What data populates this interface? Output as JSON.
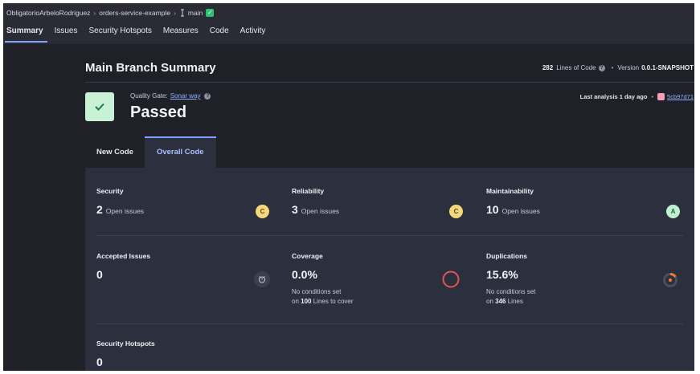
{
  "breadcrumb": {
    "organization": "ObligatorioArbeloRodriguez",
    "project": "orders-service-example",
    "separator": "›",
    "branch": "main"
  },
  "nav": {
    "tabs": [
      "Summary",
      "Issues",
      "Security Hotspots",
      "Measures",
      "Code",
      "Activity"
    ],
    "active": "Summary"
  },
  "summary": {
    "title": "Main Branch Summary",
    "lines_of_code_value": "282",
    "lines_of_code_label": "Lines of Code",
    "version_label": "Version",
    "version_value": "0.0.1-SNAPSHOT"
  },
  "quality_gate": {
    "label": "Quality Gate:",
    "link": "Sonar way",
    "status": "Passed",
    "last_analysis": "Last analysis 1 day ago",
    "commit": "5cb97d71"
  },
  "code_tabs": {
    "new_code": "New Code",
    "overall_code": "Overall Code",
    "active": "Overall Code"
  },
  "measures": {
    "security": {
      "title": "Security",
      "value": "2",
      "unit": "Open issues",
      "rating": "C"
    },
    "reliability": {
      "title": "Reliability",
      "value": "3",
      "unit": "Open issues",
      "rating": "C"
    },
    "maintainability": {
      "title": "Maintainability",
      "value": "10",
      "unit": "Open issues",
      "rating": "A"
    },
    "accepted_issues": {
      "title": "Accepted Issues",
      "value": "0"
    },
    "coverage": {
      "title": "Coverage",
      "value": "0.0%",
      "note_line1": "No conditions set",
      "note_prefix": "on",
      "note_number": "100",
      "note_suffix": "Lines to cover",
      "fraction": 0.0
    },
    "duplications": {
      "title": "Duplications",
      "value": "15.6%",
      "note_line1": "No conditions set",
      "note_prefix": "on",
      "note_number": "346",
      "note_suffix": "Lines",
      "fraction": 0.156
    },
    "security_hotspots": {
      "title": "Security Hotspots",
      "value": "0"
    }
  },
  "colors": {
    "accent": "#7fa3ff",
    "passed": "#2fbf71",
    "rating_c": "#f6d77a",
    "rating_a": "#bff0cf",
    "coverage_ring": "#e0574f",
    "duplication_ring": "#f07a2e"
  },
  "icons": {
    "branch": "branch-icon",
    "check": "check-icon",
    "help": "help-icon",
    "accepted": "accepted-issues-icon",
    "commit": "commit-avatar-icon"
  }
}
